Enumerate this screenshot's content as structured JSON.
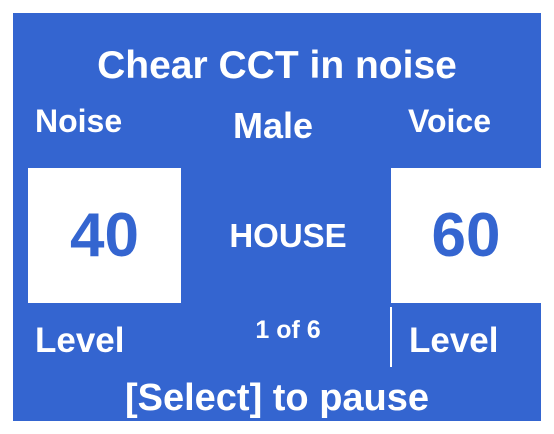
{
  "title": "Chear CCT in noise",
  "noise": {
    "heading": "Noise",
    "level_value": "40",
    "level_label": "Level"
  },
  "talker": {
    "heading": "Male",
    "current_word": "HOUSE",
    "progress": "1 of 6"
  },
  "voice": {
    "heading": "Voice",
    "level_value": "60",
    "level_label": "Level"
  },
  "footer": {
    "instruction": "[Select] to pause"
  },
  "colors": {
    "panel_background": "#3465d0",
    "text": "#ffffff",
    "box_background": "#ffffff",
    "box_text": "#3465d0"
  }
}
